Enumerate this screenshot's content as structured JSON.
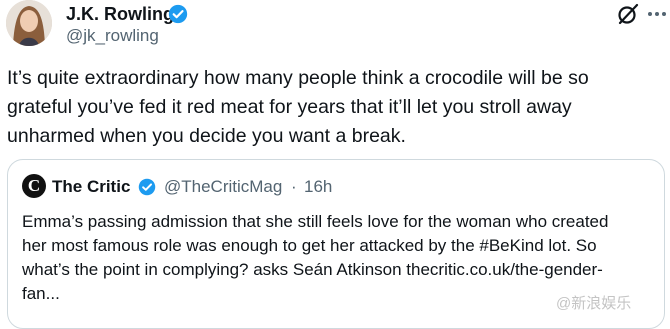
{
  "author": {
    "name": "J.K. Rowling",
    "handle": "@jk_rowling",
    "verified": true
  },
  "tweet": {
    "text": "It’s quite extraordinary how many people think a crocodile will be so\ngrateful you’ve fed it red meat for years that it’ll let you stroll away\nunharmed when you decide you want a break."
  },
  "quote": {
    "logo_letter": "C",
    "name": "The Critic",
    "verified": true,
    "handle": "@TheCriticMag",
    "separator": "·",
    "time": "16h",
    "text": "Emma’s passing admission that she still feels love for the woman who created\nher most famous role was enough to get her attacked by the #BeKind lot. So\nwhat’s the point in complying? asks Seán Atkinson thecritic.co.uk/the-gender-\nfan..."
  },
  "watermark": "@新浪娱乐",
  "icons": [
    "verified-badge-icon",
    "grok-icon",
    "more-options-icon"
  ],
  "colors": {
    "text": "#0f1419",
    "secondary": "#536471",
    "verified": "#1d9bf0",
    "border": "#cfd9de"
  }
}
